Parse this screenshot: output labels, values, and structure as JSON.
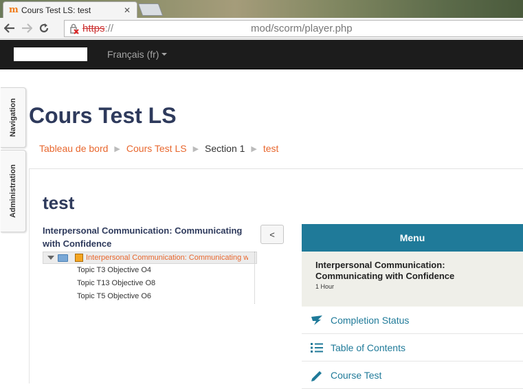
{
  "browser": {
    "tab_title": "Cours Test LS: test",
    "tab_favicon_glyph": "m",
    "url_scheme": "https",
    "url_sep": "://",
    "url_path": "mod/scorm/player.php"
  },
  "navbar": {
    "language": "Français (fr)"
  },
  "dock": {
    "navigation": "Navigation",
    "administration": "Administration"
  },
  "page": {
    "title": "Cours Test LS",
    "breadcrumb": [
      "Tableau de bord",
      "Cours Test LS",
      "Section 1",
      "test"
    ],
    "activity_title": "test"
  },
  "toc": {
    "heading": "Interpersonal Communication: Communicating with Confidence",
    "root_label": "Interpersonal Communication: Communicating with Confidence",
    "items": [
      "Topic T3 Objective O4",
      "Topic T13 Objective O8",
      "Topic T5 Objective O6"
    ],
    "collapse_label": "<"
  },
  "player": {
    "menu_label": "Menu",
    "course_name": "Interpersonal Communication: Communicating with Confidence",
    "duration": "1 Hour",
    "items": [
      {
        "label": "Completion Status",
        "icon": "completion-icon"
      },
      {
        "label": "Table of Contents",
        "icon": "list-icon"
      },
      {
        "label": "Course Test",
        "icon": "pencil-icon"
      }
    ]
  },
  "colors": {
    "accent": "#e8672e",
    "title": "#2e3a5c",
    "player_teal": "#1f7a99",
    "navbar": "#1c1c1c"
  }
}
